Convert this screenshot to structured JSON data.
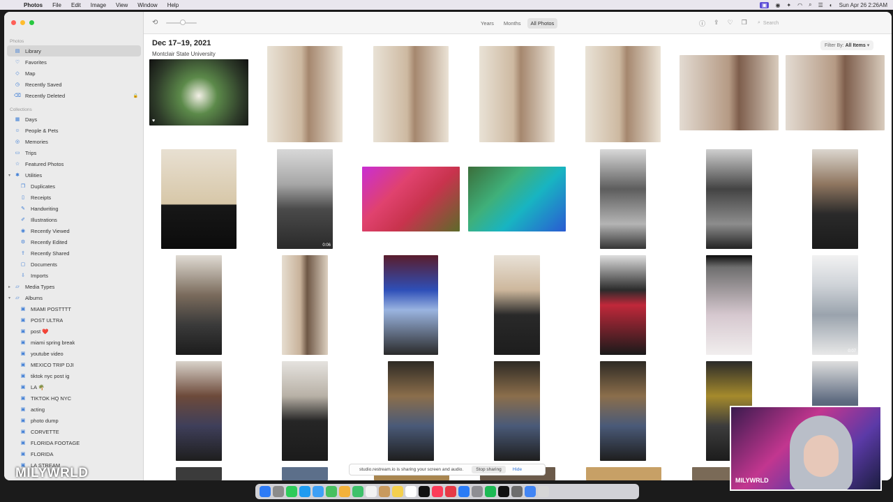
{
  "menubar": {
    "apple_icon": "apple-icon",
    "app": "Photos",
    "menus": [
      "File",
      "Edit",
      "Image",
      "View",
      "Window",
      "Help"
    ],
    "clock": "Sun Apr 26  2:26AM"
  },
  "sidebar": {
    "section_photos": "Photos",
    "main_items": [
      {
        "label": "Library",
        "icon": "library-icon",
        "selected": true
      },
      {
        "label": "Favorites",
        "icon": "heart-icon"
      },
      {
        "label": "Map",
        "icon": "map-icon"
      },
      {
        "label": "Recently Saved",
        "icon": "clock-icon"
      },
      {
        "label": "Recently Deleted",
        "icon": "trash-icon",
        "locked": true
      }
    ],
    "section_collections": "Collections",
    "collection_items": [
      {
        "label": "Days",
        "icon": "calendar-icon"
      },
      {
        "label": "People & Pets",
        "icon": "person-icon"
      },
      {
        "label": "Memories",
        "icon": "memories-icon"
      },
      {
        "label": "Trips",
        "icon": "suitcase-icon"
      },
      {
        "label": "Featured Photos",
        "icon": "star-icon"
      },
      {
        "label": "Utilities",
        "icon": "utilities-icon",
        "expanded": true
      }
    ],
    "utility_items": [
      {
        "label": "Duplicates",
        "icon": "duplicate-icon"
      },
      {
        "label": "Receipts",
        "icon": "receipt-icon"
      },
      {
        "label": "Handwriting",
        "icon": "pen-icon"
      },
      {
        "label": "Illustrations",
        "icon": "brush-icon"
      },
      {
        "label": "Recently Viewed",
        "icon": "eye-icon"
      },
      {
        "label": "Recently Edited",
        "icon": "edit-icon"
      },
      {
        "label": "Recently Shared",
        "icon": "share-icon"
      },
      {
        "label": "Documents",
        "icon": "document-icon"
      },
      {
        "label": "Imports",
        "icon": "import-icon"
      }
    ],
    "media_types": "Media Types",
    "albums_header": "Albums",
    "albums": [
      "MIAMI POSTTTT",
      "POST ULTRA",
      "post ❤️",
      "miami spring break",
      "youtube video",
      "MEXICO TRIP DJI",
      "tiktok nyc post ig",
      "LA 🌴",
      "TIKTOK HQ NYC",
      "acting",
      "photo dump",
      "CORVETTE",
      "FLORIDA FOOTAGE",
      "FLORIDA",
      "LA STREAM"
    ]
  },
  "toolbar": {
    "rotate_icon": "rotate-icon",
    "tabs": [
      "Years",
      "Months",
      "All Photos"
    ],
    "active_tab": "All Photos",
    "actions": [
      "info-icon",
      "share-icon",
      "heart-icon",
      "copy-icon"
    ],
    "search_placeholder": "Search"
  },
  "content": {
    "date": "Dec 17–19, 2021",
    "location": "Montclair State University",
    "filter_label": "Filter By:",
    "filter_value": "All Items",
    "durations": {
      "laptop_video": "0:06",
      "control_video": "0:07"
    }
  },
  "sharebar": {
    "message": "studio.restream.io is sharing your screen and audio.",
    "stop": "Stop sharing",
    "hide": "Hide"
  },
  "overlay": {
    "watermark": "MILYWRLD",
    "cam_name": "MILYWRLD"
  },
  "colors": {
    "accent": "#3a7bd5",
    "sidebar_bg": "#ebebeb",
    "screen_share_purple": "#5a4bd6"
  }
}
